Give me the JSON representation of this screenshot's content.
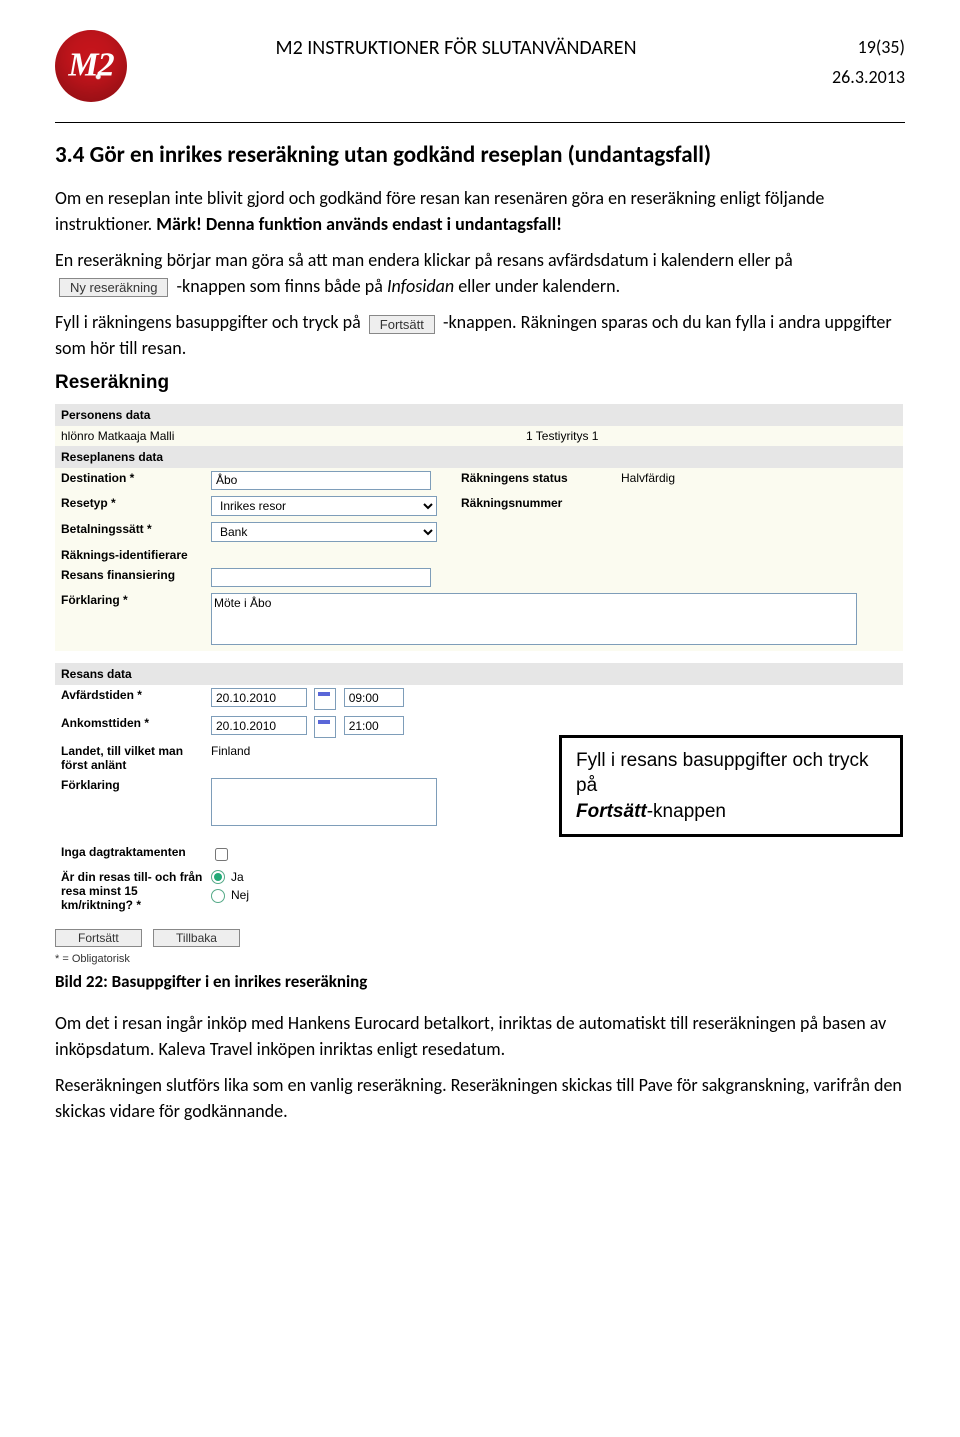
{
  "header": {
    "title": "M2 INSTRUKTIONER FÖR SLUTANVÄNDAREN",
    "page_indicator": "19(35)",
    "date": "26.3.2013",
    "logo_text": "M2"
  },
  "section": {
    "number_title": "3.4  Gör en inrikes reseräkning utan godkänd reseplan (undantagsfall)",
    "para1": "Om en reseplan inte blivit gjord och godkänd före resan kan resenären göra en reseräkning enligt följande instruktioner. ",
    "mark_bold": "Märk! Denna funktion används endast i undantagsfall!",
    "para2": "En reseräkning börjar man göra så att man endera klickar på resans avfärdsdatum i kalendern eller på",
    "chip_ny": "Ny reseräkning",
    "para2_tail_a": " -knappen som finns både på ",
    "para2_tail_b": "Infosidan",
    "para2_tail_c": " eller under kalendern.",
    "para3_a": "Fyll i räkningens basuppgifter och tryck på ",
    "chip_fortsatt": "Fortsätt",
    "para3_b": "-knappen. Räkningen sparas och du kan fylla i andra uppgifter som hör till resan."
  },
  "form": {
    "title": "Reseräkning",
    "band_person": "Personens data",
    "person_left": "hlönro Matkaaja Malli",
    "person_right": "1 Testiyritys 1",
    "band_plan": "Reseplanens data",
    "labels": {
      "destination": "Destination *",
      "resetyp": "Resetyp *",
      "betalningssatt": "Betalningssätt *",
      "rakningsid": "Räknings-identifierare",
      "finansiering": "Resans finansiering",
      "forklaring": "Förklaring *",
      "raknstatus": "Räkningens status",
      "raknnr": "Räkningsnummer",
      "avfardstiden": "Avfärdstiden *",
      "ankomsttiden": "Ankomsttiden *",
      "landet": "Landet, till vilket man först anlänt",
      "forklaring2": "Förklaring",
      "inga_dag": "Inga dagtraktamenten",
      "minst15": "Är din resas till- och från resa minst 15 km/riktning? *"
    },
    "values": {
      "destination": "Åbo",
      "resetyp": "Inrikes resor",
      "betalningssatt": "Bank",
      "status": "Halvfärdig",
      "forklaring": "Möte i Åbo",
      "avf_date": "20.10.2010",
      "avf_time": "09:00",
      "ank_date": "20.10.2010",
      "ank_time": "21:00",
      "landet": "Finland",
      "ja": "Ja",
      "nej": "Nej"
    },
    "band_resans": "Resans data",
    "callout_l1": "Fyll i resans basuppgifter och tryck på",
    "callout_l2_pre": "",
    "callout_l2_em": "Fortsätt",
    "callout_l2_post": "-knappen",
    "buttons": {
      "fortsatt": "Fortsätt",
      "tillbaka": "Tillbaka"
    },
    "oblig": "* = Obligatorisk"
  },
  "caption": "Bild 22: Basuppgifter i en inrikes reseräkning",
  "trailing": {
    "p1": "Om det i resan ingår inköp med Hankens Eurocard betalkort, inriktas de automatiskt till reseräkningen på basen av inköpsdatum. Kaleva Travel inköpen inriktas enligt resedatum.",
    "p2": "Reseräkningen slutförs lika som en vanlig reseräkning. Reseräkningen skickas till Pave för sakgranskning, varifrån den skickas vidare för godkännande."
  }
}
